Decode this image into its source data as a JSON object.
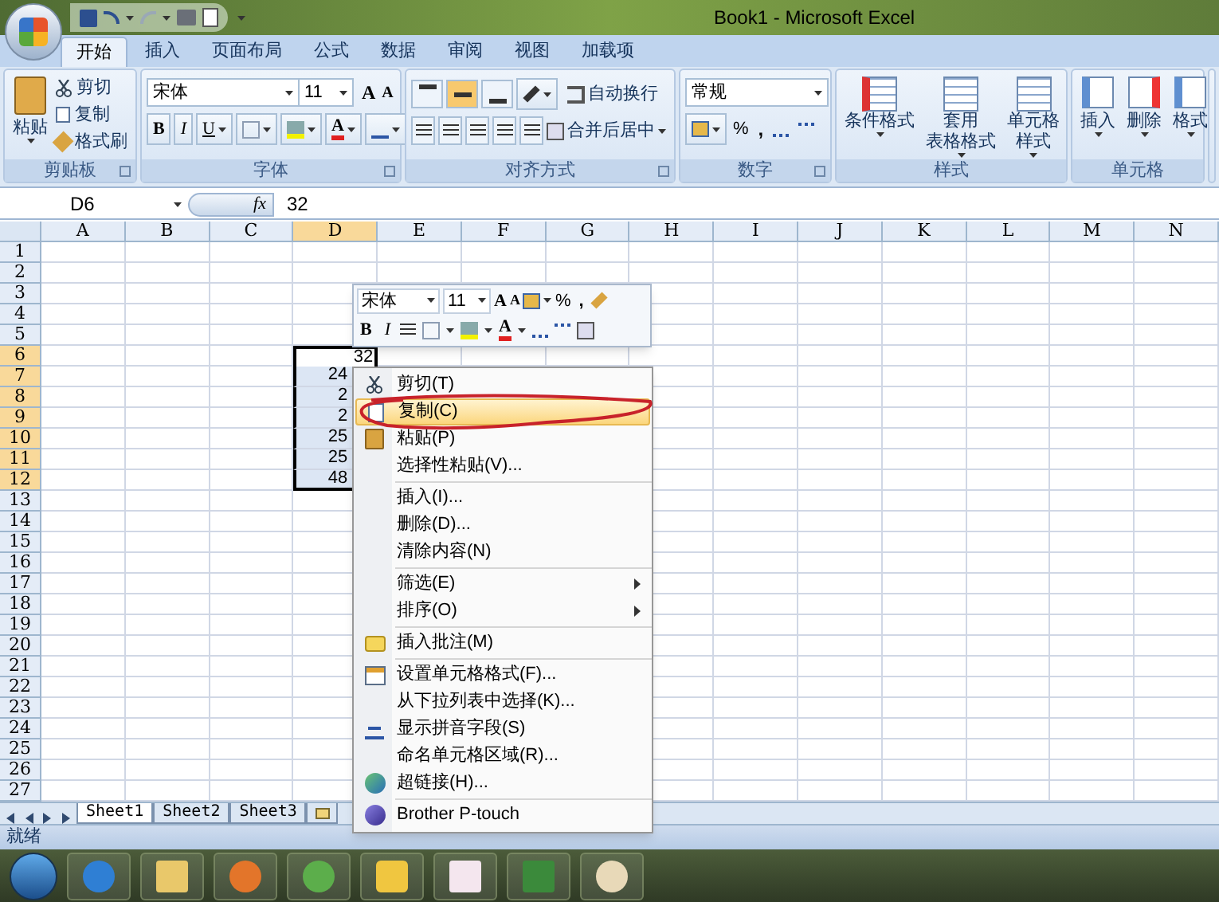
{
  "window": {
    "title": "Book1 - Microsoft Excel"
  },
  "ribbon_tabs": [
    {
      "label": "开始",
      "selected": true
    },
    {
      "label": "插入",
      "selected": false
    },
    {
      "label": "页面布局",
      "selected": false
    },
    {
      "label": "公式",
      "selected": false
    },
    {
      "label": "数据",
      "selected": false
    },
    {
      "label": "审阅",
      "selected": false
    },
    {
      "label": "视图",
      "selected": false
    },
    {
      "label": "加载项",
      "selected": false
    }
  ],
  "ribbon": {
    "clipboard": {
      "label": "剪贴板",
      "paste": "粘贴",
      "cut": "剪切",
      "copy": "复制",
      "format_painter": "格式刷"
    },
    "font": {
      "label": "字体",
      "font_name": "宋体",
      "font_size": "11",
      "grow": "A",
      "shrink": "A",
      "bold": "B",
      "italic": "I",
      "underline": "U",
      "font_color": "A"
    },
    "alignment": {
      "label": "对齐方式",
      "vertical": [
        {
          "selected": false
        },
        {
          "selected": true
        },
        {
          "selected": false
        }
      ],
      "wrap_text": "自动换行",
      "merge_center": "合并后居中"
    },
    "number": {
      "label": "数字",
      "format": "常规",
      "percent": "%",
      "comma": ","
    },
    "styles": {
      "label": "样式",
      "buttons": [
        {
          "lines": [
            "条件格式"
          ]
        },
        {
          "lines": [
            "套用",
            "表格格式"
          ]
        },
        {
          "lines": [
            "单元格",
            "样式"
          ]
        }
      ]
    },
    "cells": {
      "label": "单元格",
      "buttons": [
        "插入",
        "删除",
        "格式"
      ]
    }
  },
  "formula_bar": {
    "name_box": "D6",
    "function_label": "fx",
    "value": "32"
  },
  "columns": [
    {
      "label": "A",
      "selected": false
    },
    {
      "label": "B",
      "selected": false
    },
    {
      "label": "C",
      "selected": false
    },
    {
      "label": "D",
      "selected": true
    },
    {
      "label": "E",
      "selected": false
    },
    {
      "label": "F",
      "selected": false
    },
    {
      "label": "G",
      "selected": false
    },
    {
      "label": "H",
      "selected": false
    },
    {
      "label": "I",
      "selected": false
    },
    {
      "label": "J",
      "selected": false
    },
    {
      "label": "K",
      "selected": false
    },
    {
      "label": "L",
      "selected": false
    },
    {
      "label": "M",
      "selected": false
    },
    {
      "label": "N",
      "selected": false
    }
  ],
  "rows": [
    {
      "label": "1",
      "selected": false
    },
    {
      "label": "2",
      "selected": false
    },
    {
      "label": "3",
      "selected": false
    },
    {
      "label": "4",
      "selected": false
    },
    {
      "label": "5",
      "selected": false
    },
    {
      "label": "6",
      "selected": true,
      "column_d": "32"
    },
    {
      "label": "7",
      "selected": true,
      "column_d": "24"
    },
    {
      "label": "8",
      "selected": true,
      "column_d": "2"
    },
    {
      "label": "9",
      "selected": true,
      "column_d": "2"
    },
    {
      "label": "10",
      "selected": true,
      "column_d": "25"
    },
    {
      "label": "11",
      "selected": true,
      "column_d": "25"
    },
    {
      "label": "12",
      "selected": true,
      "column_d": "48"
    },
    {
      "label": "13",
      "selected": false
    },
    {
      "label": "14",
      "selected": false
    },
    {
      "label": "15",
      "selected": false
    },
    {
      "label": "16",
      "selected": false
    },
    {
      "label": "17",
      "selected": false
    },
    {
      "label": "18",
      "selected": false
    },
    {
      "label": "19",
      "selected": false
    },
    {
      "label": "20",
      "selected": false
    },
    {
      "label": "21",
      "selected": false
    },
    {
      "label": "22",
      "selected": false
    },
    {
      "label": "23",
      "selected": false
    },
    {
      "label": "24",
      "selected": false
    },
    {
      "label": "25",
      "selected": false
    },
    {
      "label": "26",
      "selected": false
    },
    {
      "label": "27",
      "selected": false
    }
  ],
  "mini_toolbar": {
    "font_name": "宋体",
    "font_size": "11",
    "grow": "A",
    "shrink": "A",
    "percent": "%",
    "comma": ",",
    "bold": "B",
    "italic": "I",
    "font_color": "A"
  },
  "context_menu": [
    {
      "kind": "item",
      "label": "剪切(T)",
      "selected": false,
      "submenu": false
    },
    {
      "kind": "item",
      "label": "复制(C)",
      "selected": true,
      "submenu": false
    },
    {
      "kind": "item",
      "label": "粘贴(P)",
      "selected": false,
      "submenu": false
    },
    {
      "kind": "item",
      "label": "选择性粘贴(V)...",
      "selected": false,
      "submenu": false
    },
    {
      "kind": "separator"
    },
    {
      "kind": "item",
      "label": "插入(I)...",
      "selected": false,
      "submenu": false
    },
    {
      "kind": "item",
      "label": "删除(D)...",
      "selected": false,
      "submenu": false
    },
    {
      "kind": "item",
      "label": "清除内容(N)",
      "selected": false,
      "submenu": false
    },
    {
      "kind": "separator"
    },
    {
      "kind": "item",
      "label": "筛选(E)",
      "selected": false,
      "submenu": true
    },
    {
      "kind": "item",
      "label": "排序(O)",
      "selected": false,
      "submenu": true
    },
    {
      "kind": "separator"
    },
    {
      "kind": "item",
      "label": "插入批注(M)",
      "selected": false,
      "submenu": false
    },
    {
      "kind": "separator"
    },
    {
      "kind": "item",
      "label": "设置单元格格式(F)...",
      "selected": false,
      "submenu": false
    },
    {
      "kind": "item",
      "label": "从下拉列表中选择(K)...",
      "selected": false,
      "submenu": false
    },
    {
      "kind": "item",
      "label": "显示拼音字段(S)",
      "selected": false,
      "submenu": false
    },
    {
      "kind": "item",
      "label": "命名单元格区域(R)...",
      "selected": false,
      "submenu": false
    },
    {
      "kind": "item",
      "label": "超链接(H)...",
      "selected": false,
      "submenu": false
    },
    {
      "kind": "separator"
    },
    {
      "kind": "item",
      "label": "Brother P-touch",
      "selected": false,
      "submenu": false
    }
  ],
  "sheet_tabs": [
    {
      "label": "Sheet1",
      "selected": true
    },
    {
      "label": "Sheet2",
      "selected": false
    },
    {
      "label": "Sheet3",
      "selected": false
    }
  ],
  "status_bar": {
    "text": "就绪"
  }
}
